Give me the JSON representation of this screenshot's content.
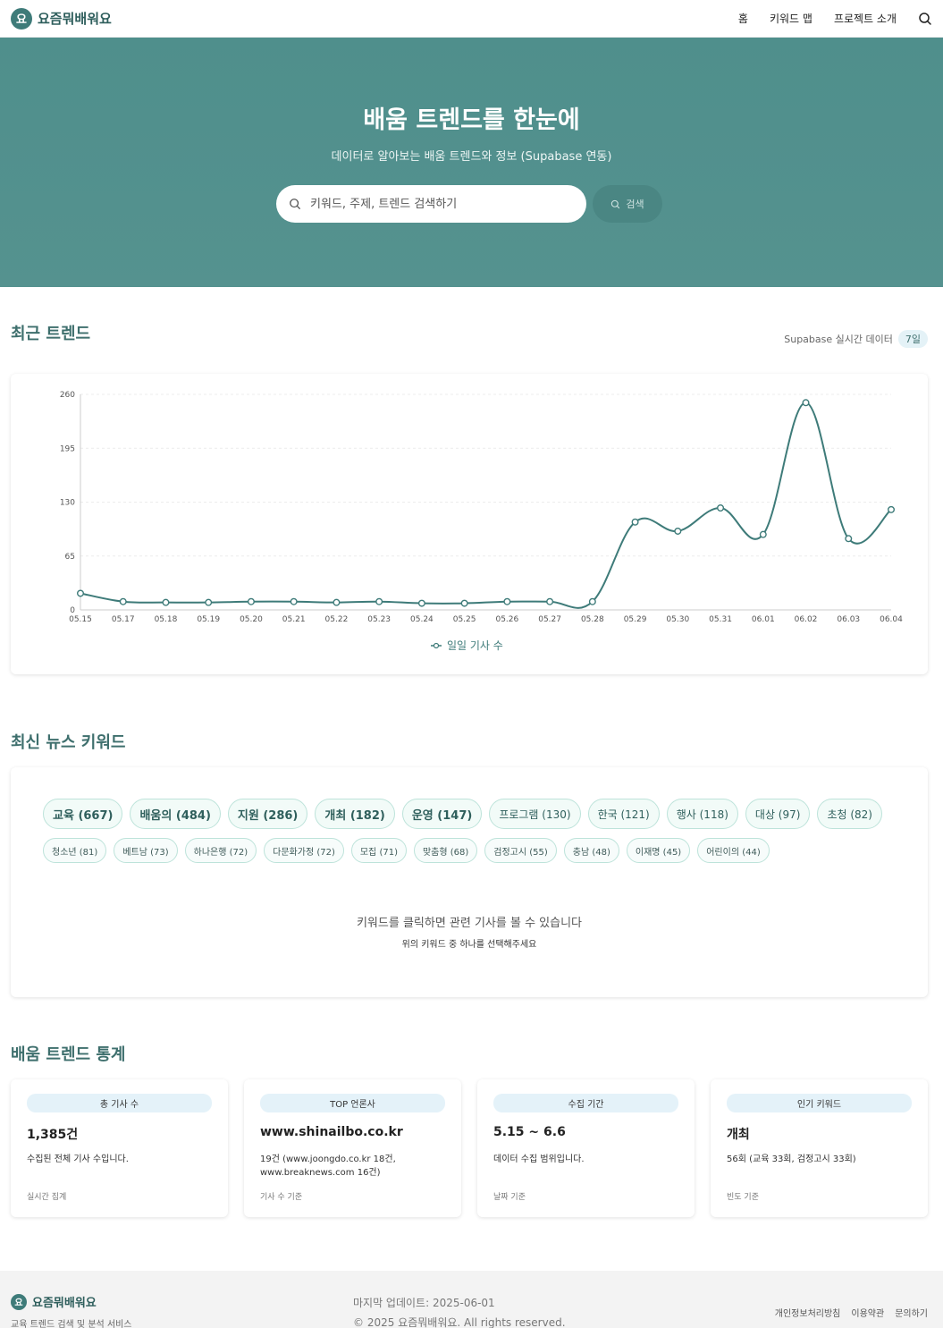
{
  "header": {
    "logo_char": "요",
    "brand": "요즘뭐배워요",
    "nav": [
      {
        "label": "홈"
      },
      {
        "label": "키워드 맵"
      },
      {
        "label": "프로젝트 소개"
      }
    ]
  },
  "hero": {
    "title": "배움 트렌드를 한눈에",
    "subtitle": "데이터로 알아보는 배움 트렌드와 정보 (Supabase 연동)",
    "search_placeholder": "키워드, 주제, 트렌드 검색하기",
    "search_button": "검색"
  },
  "trend": {
    "title": "최근 트렌드",
    "source": "Supabase 실시간 데이터",
    "period": "7일"
  },
  "chart_data": {
    "type": "line",
    "x": [
      "05.15",
      "05.17",
      "05.18",
      "05.19",
      "05.20",
      "05.21",
      "05.22",
      "05.23",
      "05.24",
      "05.25",
      "05.26",
      "05.27",
      "05.28",
      "05.29",
      "05.30",
      "05.31",
      "06.01",
      "06.02",
      "06.03",
      "06.04"
    ],
    "series": [
      {
        "name": "일일 기사 수",
        "values": [
          20,
          10,
          9,
          9,
          10,
          10,
          9,
          10,
          8,
          8,
          10,
          10,
          10,
          106,
          95,
          123,
          91,
          250,
          86,
          121
        ]
      }
    ],
    "yticks": [
      0,
      65,
      130,
      195,
      260
    ],
    "ylim": [
      0,
      260
    ],
    "grid": true,
    "legend": "bottom-center",
    "color": "#3e7b79"
  },
  "keywords": {
    "title": "최신 뉴스 키워드",
    "row1": [
      {
        "label": "교육 (667)"
      },
      {
        "label": "배움의 (484)"
      },
      {
        "label": "지원 (286)"
      },
      {
        "label": "개최 (182)"
      },
      {
        "label": "운영 (147)"
      },
      {
        "label": "프로그램 (130)"
      },
      {
        "label": "한국 (121)"
      },
      {
        "label": "행사 (118)"
      },
      {
        "label": "대상 (97)"
      },
      {
        "label": "초청 (82)"
      }
    ],
    "row2": [
      {
        "label": "청소년 (81)"
      },
      {
        "label": "베트남 (73)"
      },
      {
        "label": "하나은행 (72)"
      },
      {
        "label": "다문화가정 (72)"
      },
      {
        "label": "모집 (71)"
      },
      {
        "label": "맞춤형 (68)"
      },
      {
        "label": "검정고시 (55)"
      },
      {
        "label": "충남 (48)"
      },
      {
        "label": "이재명 (45)"
      },
      {
        "label": "어린이의 (44)"
      }
    ],
    "hint_main": "키워드를 클릭하면 관련 기사를 볼 수 있습니다",
    "hint_sub": "위의 키워드 중 하나를 선택해주세요"
  },
  "stats": {
    "title": "배움 트렌드 통계",
    "cards": [
      {
        "label": "총 기사 수",
        "value": "1,385건",
        "desc": "수집된 전체 기사 수입니다.",
        "foot": "실시간 집계"
      },
      {
        "label": "TOP 언론사",
        "value": "www.shinailbo.co.kr",
        "desc": "19건 (www.joongdo.co.kr 18건, www.breaknews.com 16건)",
        "foot": "기사 수 기준"
      },
      {
        "label": "수집 기간",
        "value": "5.15 ~ 6.6",
        "desc": "데이터 수집 범위입니다.",
        "foot": "날짜 기준"
      },
      {
        "label": "인기 키워드",
        "value": "개최",
        "desc": "56회 (교육 33회, 검정고시 33회)",
        "foot": "빈도 기준"
      }
    ]
  },
  "footer": {
    "brand": "요즘뭐배워요",
    "tagline": "교육 트렌드 검색 및 분석 서비스",
    "updated": "마지막 업데이트: 2025-06-01",
    "copyright": "© 2025 요즘뭐배워요. All rights reserved.",
    "links": [
      {
        "label": "개인정보처리방침"
      },
      {
        "label": "이용약관"
      },
      {
        "label": "문의하기"
      }
    ]
  }
}
